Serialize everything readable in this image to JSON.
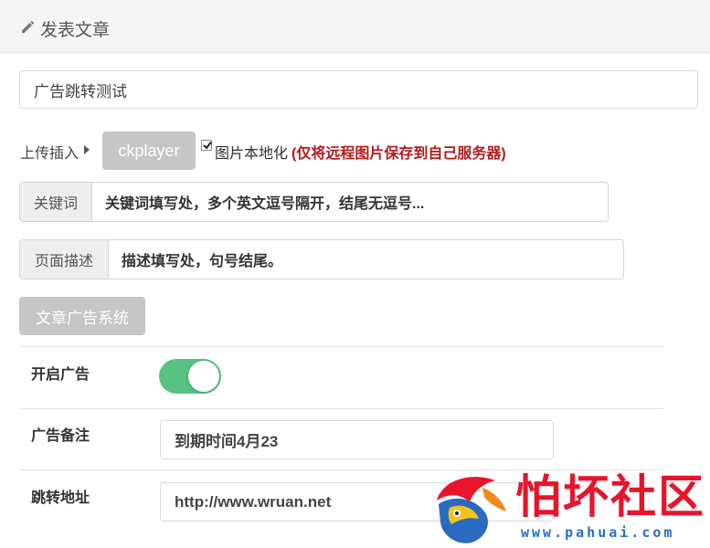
{
  "header": {
    "title": "发表文章",
    "icon": "pencil-icon"
  },
  "form": {
    "title_value": "广告跳转测试",
    "upload_label": "上传插入",
    "ckplayer_label": "ckplayer",
    "localize_checked": true,
    "localize_label": "图片本地化",
    "localize_note": "(仅将远程图片保存到自己服务器)",
    "keywords_addon": "关键词",
    "keywords_value": "关键词填写处，多个英文逗号隔开，结尾无逗号...",
    "description_addon": "页面描述",
    "description_value": "描述填写处，句号结尾。",
    "ad_system_label": "文章广告系统"
  },
  "ad": {
    "enable_label": "开启广告",
    "enabled": true,
    "remark_label": "广告备注",
    "remark_value": "到期时间4月23",
    "url_label": "跳转地址",
    "url_value": "http://www.wruan.net"
  },
  "watermark": {
    "name": "怕坏社区",
    "url": "www.pahuai.com"
  },
  "colors": {
    "toggle_on": "#58c383",
    "note_red": "#b31b1b",
    "button_grey": "#c6c6c6",
    "watermark_red": "#e8142c",
    "watermark_blue": "#2a6bc2"
  }
}
